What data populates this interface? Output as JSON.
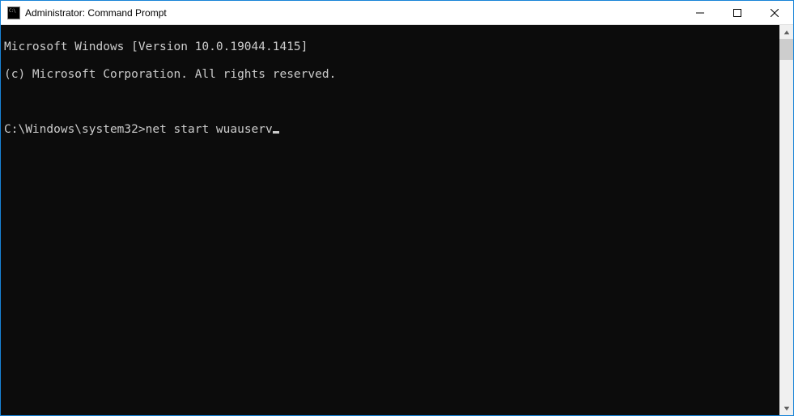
{
  "window": {
    "title": "Administrator: Command Prompt"
  },
  "terminal": {
    "line1": "Microsoft Windows [Version 10.0.19044.1415]",
    "line2": "(c) Microsoft Corporation. All rights reserved.",
    "blank": "",
    "prompt": "C:\\Windows\\system32>",
    "command": "net start wuauserv"
  }
}
